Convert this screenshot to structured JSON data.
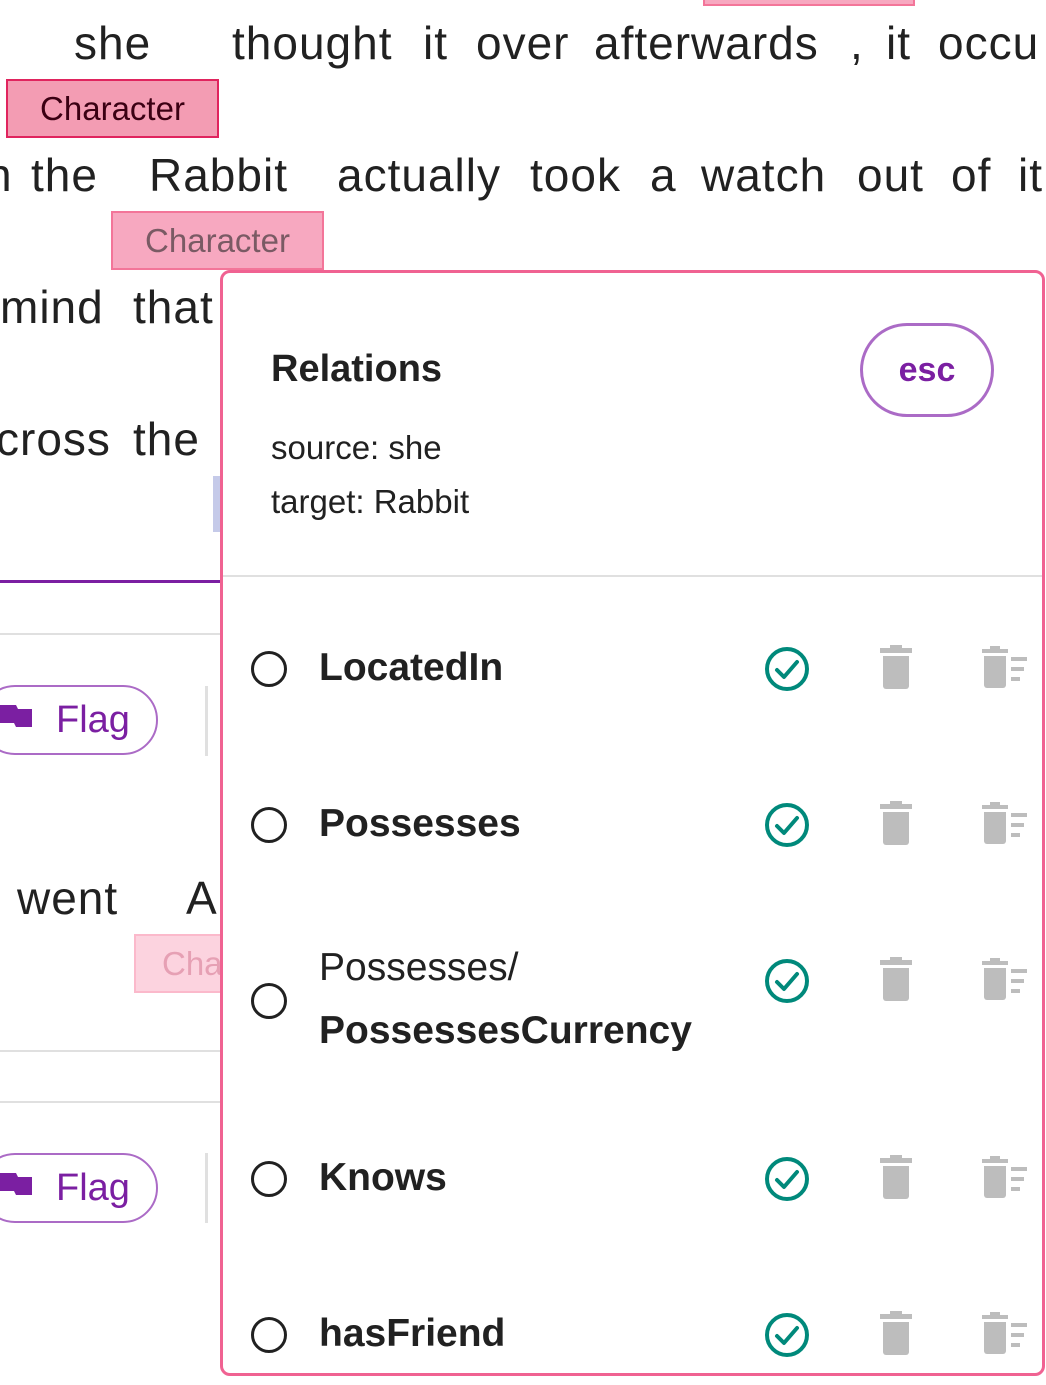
{
  "text_lines": {
    "line1": [
      "she",
      "thought",
      "it",
      "over",
      "afterwards",
      ",",
      "it",
      "occu"
    ],
    "line2": [
      "n",
      "the",
      "Rabbit",
      "actually",
      "took",
      "a",
      "watch",
      "out",
      "of",
      "it"
    ],
    "line3": [
      "mind",
      "that"
    ],
    "line4": [
      "cross",
      "the"
    ],
    "line5": [
      "went",
      "A"
    ]
  },
  "tags": {
    "she_tag": "Character",
    "rabbit_tag": "Character",
    "went_tag": "Cha"
  },
  "flag_buttons": {
    "top_label": "Flag",
    "bottom_label": "Flag"
  },
  "relations_popover": {
    "title": "Relations",
    "esc_label": "esc",
    "source_line": "source: she",
    "target_line": "target: Rabbit",
    "items": [
      {
        "label": "LocatedIn"
      },
      {
        "label": "Possesses"
      },
      {
        "label_prefix": "Possesses/",
        "label": "PossessesCurrency"
      },
      {
        "label": "Knows"
      },
      {
        "label": "hasFriend"
      }
    ]
  },
  "colors": {
    "accent_purple": "#7b1fa2",
    "tag_pink": "#f7a8c0",
    "tag_border": "#e0245e",
    "popover_border": "#f06292",
    "check_teal": "#00897b",
    "icon_gray": "#bdbdbd"
  },
  "icons": [
    "flag-icon",
    "check-circle-icon",
    "delete-icon",
    "delete-sweep-icon"
  ]
}
